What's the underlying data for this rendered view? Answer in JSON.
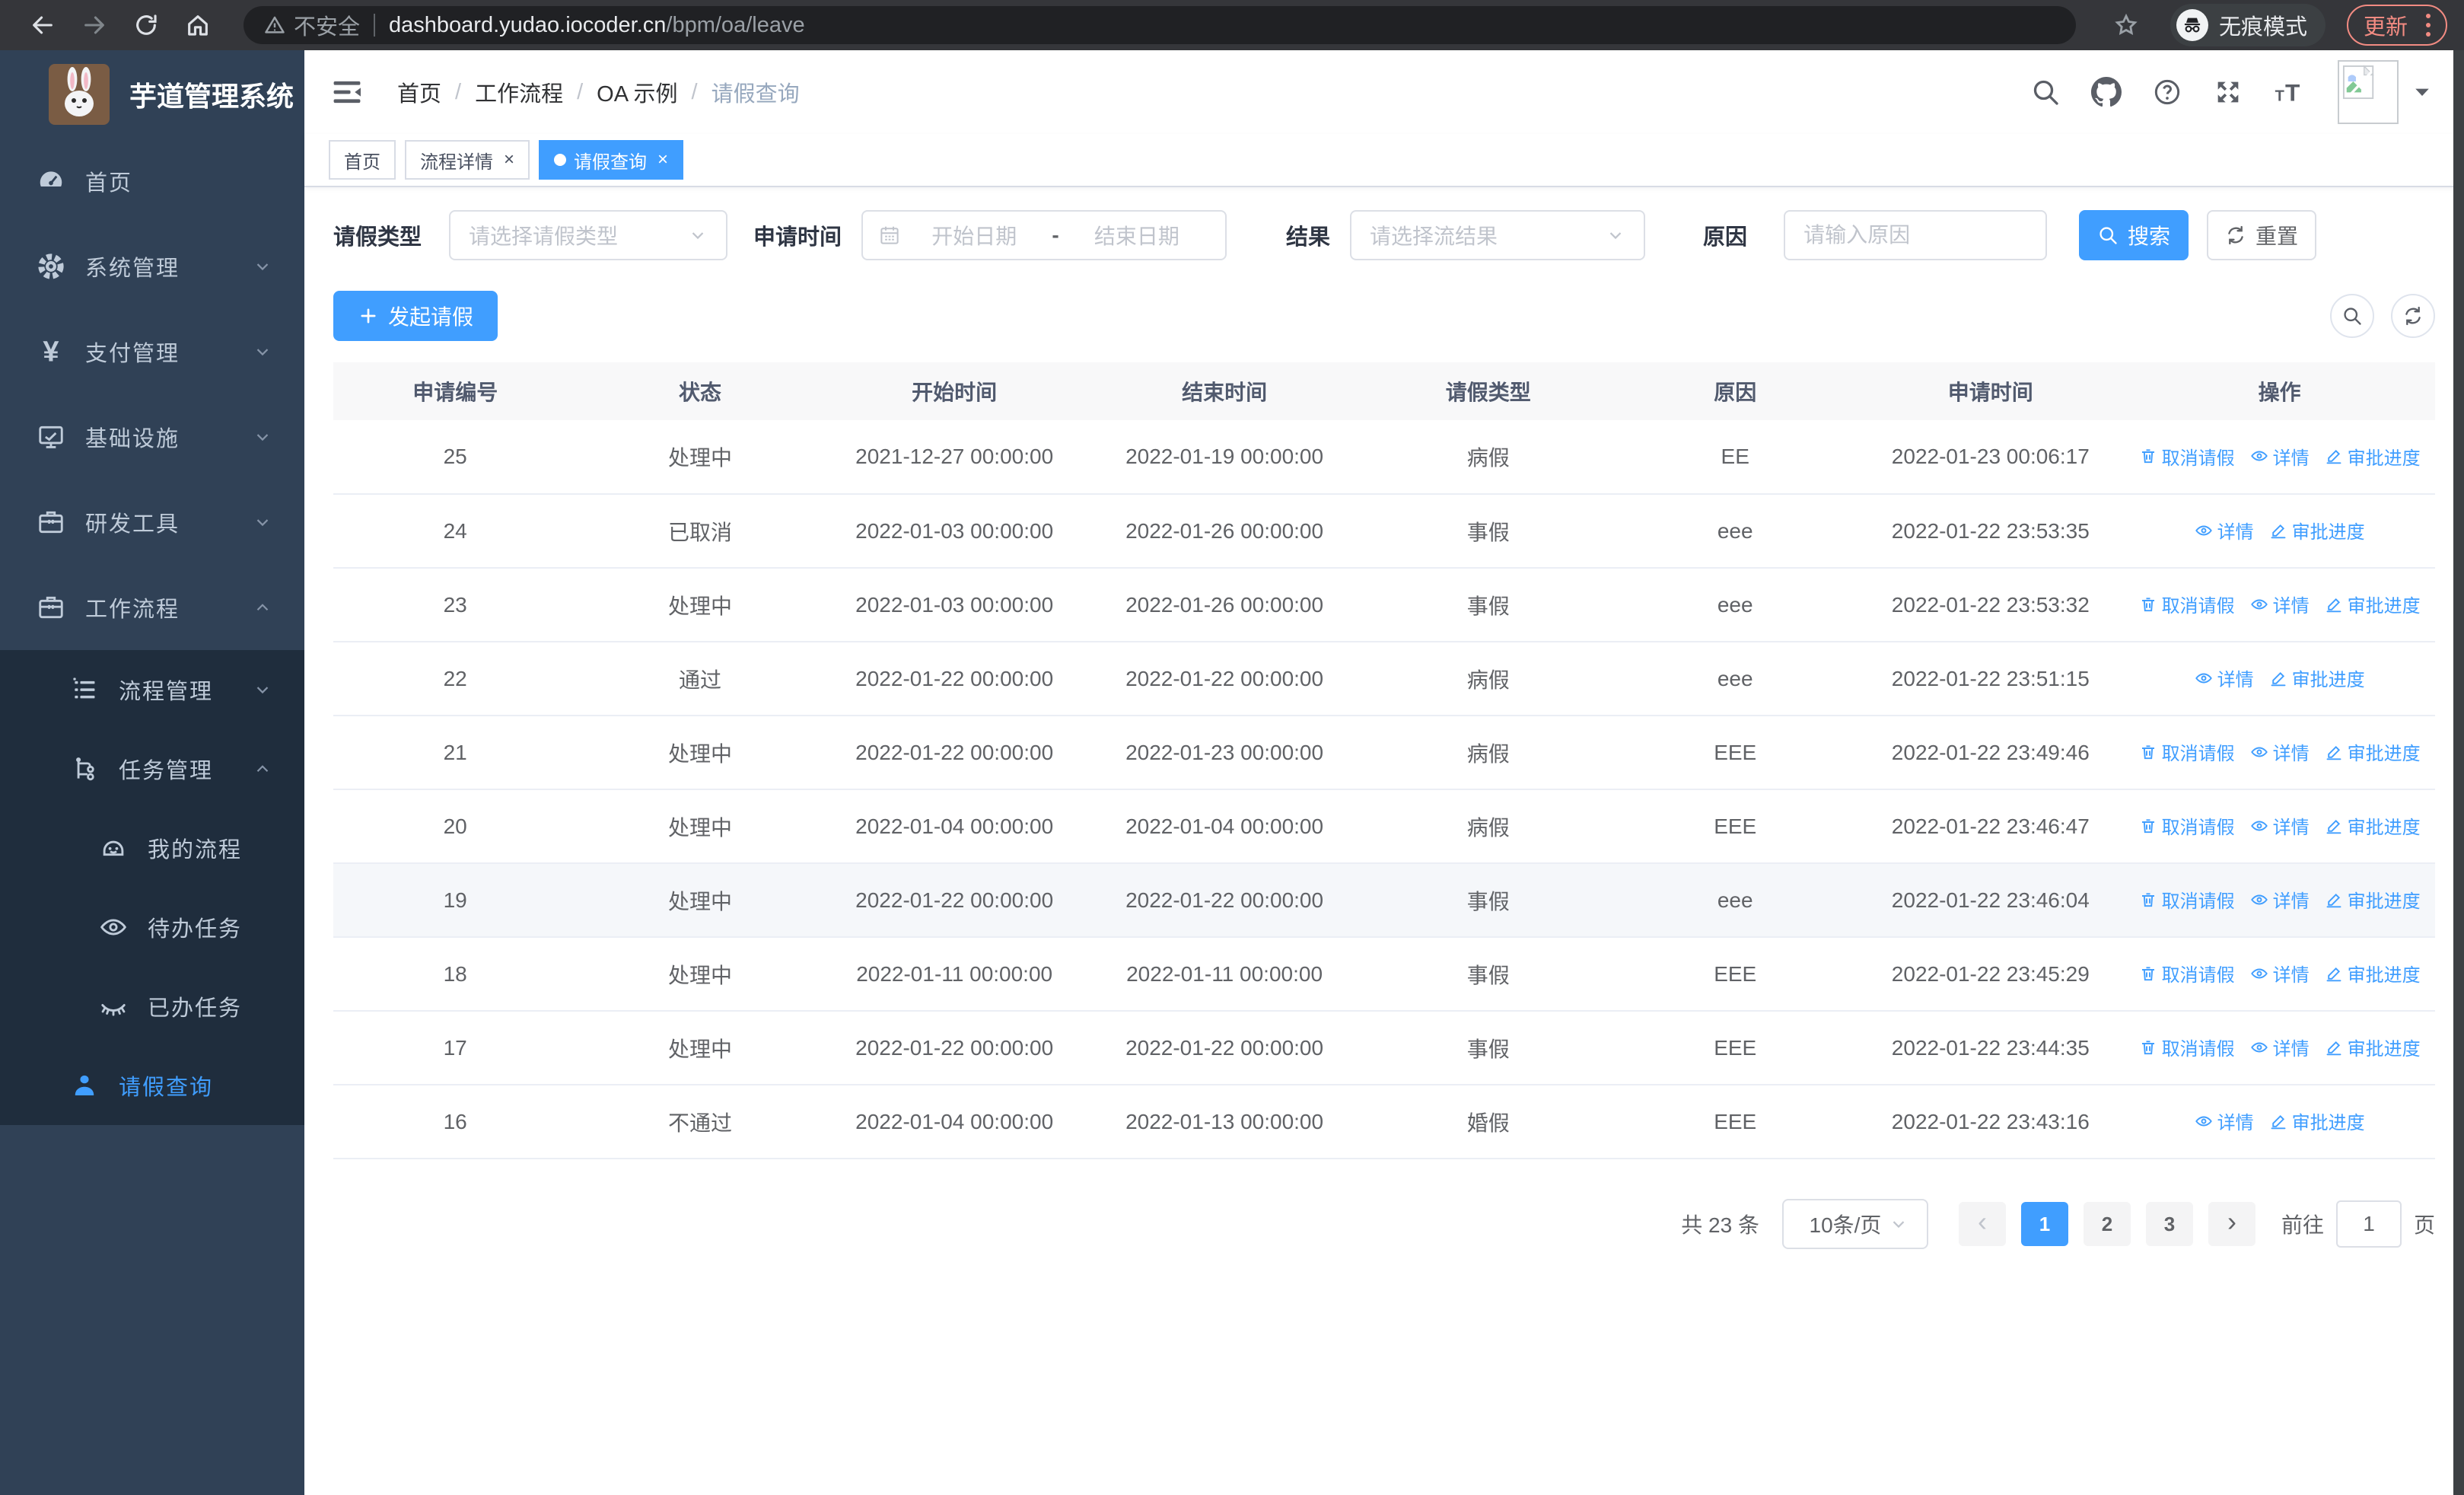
{
  "browser": {
    "security_label": "不安全",
    "url_host": "dashboard.yudao.iocoder.cn",
    "url_path": "/bpm/oa/leave",
    "incognito_label": "无痕模式",
    "update_label": "更新"
  },
  "sidebar": {
    "title": "芋道管理系统",
    "items": [
      {
        "id": "home",
        "label": "首页",
        "icon": "dashboard-icon",
        "level": 1,
        "chevron": null,
        "submenu": false,
        "active": false
      },
      {
        "id": "system",
        "label": "系统管理",
        "icon": "gear-icon",
        "level": 1,
        "chevron": "down",
        "submenu": false,
        "active": false
      },
      {
        "id": "pay",
        "label": "支付管理",
        "icon": "yen-icon",
        "level": 1,
        "chevron": "down",
        "submenu": false,
        "active": false
      },
      {
        "id": "infra",
        "label": "基础设施",
        "icon": "monitor-icon",
        "level": 1,
        "chevron": "down",
        "submenu": false,
        "active": false
      },
      {
        "id": "dev-tools",
        "label": "研发工具",
        "icon": "briefcase-icon",
        "level": 1,
        "chevron": "down",
        "submenu": false,
        "active": false
      },
      {
        "id": "workflow",
        "label": "工作流程",
        "icon": "briefcase-icon",
        "level": 1,
        "chevron": "up",
        "submenu": false,
        "active": false
      },
      {
        "id": "process-mgmt",
        "label": "流程管理",
        "icon": "list-icon",
        "level": 2,
        "chevron": "down",
        "submenu": true,
        "active": false
      },
      {
        "id": "task-mgmt",
        "label": "任务管理",
        "icon": "flow-icon",
        "level": 2,
        "chevron": "up",
        "submenu": true,
        "active": false
      },
      {
        "id": "my-process",
        "label": "我的流程",
        "icon": "robot-icon",
        "level": 3,
        "chevron": null,
        "submenu": true,
        "active": false
      },
      {
        "id": "todo-tasks",
        "label": "待办任务",
        "icon": "eye-icon",
        "level": 3,
        "chevron": null,
        "submenu": true,
        "active": false
      },
      {
        "id": "done-tasks",
        "label": "已办任务",
        "icon": "eye-closed-icon",
        "level": 3,
        "chevron": null,
        "submenu": true,
        "active": false
      },
      {
        "id": "leave-query",
        "label": "请假查询",
        "icon": "user-icon",
        "level": 2,
        "chevron": null,
        "submenu": true,
        "active": true
      }
    ]
  },
  "breadcrumb": {
    "separator": "/",
    "items": [
      "首页",
      "工作流程",
      "OA 示例",
      "请假查询"
    ]
  },
  "tabs": [
    {
      "label": "首页",
      "closable": false,
      "active": false
    },
    {
      "label": "流程详情",
      "closable": true,
      "active": false
    },
    {
      "label": "请假查询",
      "closable": true,
      "active": true
    }
  ],
  "filters": {
    "type_label": "请假类型",
    "type_placeholder": "请选择请假类型",
    "time_label": "申请时间",
    "start_placeholder": "开始日期",
    "separator": "-",
    "end_placeholder": "结束日期",
    "result_label": "结果",
    "result_placeholder": "请选择流结果",
    "reason_label": "原因",
    "reason_placeholder": "请输入原因",
    "search_label": "搜索",
    "reset_label": "重置"
  },
  "toolbar": {
    "create_label": "发起请假"
  },
  "action_defs": {
    "cancel": {
      "label": "取消请假",
      "icon": "delete"
    },
    "detail": {
      "label": "详情",
      "icon": "view"
    },
    "progress": {
      "label": "审批进度",
      "icon": "edit"
    }
  },
  "table": {
    "columns": [
      "申请编号",
      "状态",
      "开始时间",
      "结束时间",
      "请假类型",
      "原因",
      "申请时间",
      "操作"
    ],
    "rows": [
      {
        "id": "25",
        "status": "处理中",
        "start": "2021-12-27 00:00:00",
        "end": "2022-01-19 00:00:00",
        "type": "病假",
        "reason": "EE",
        "apply_time": "2022-01-23 00:06:17",
        "actions": [
          "cancel",
          "detail",
          "progress"
        ],
        "highlight": false
      },
      {
        "id": "24",
        "status": "已取消",
        "start": "2022-01-03 00:00:00",
        "end": "2022-01-26 00:00:00",
        "type": "事假",
        "reason": "eee",
        "apply_time": "2022-01-22 23:53:35",
        "actions": [
          "detail",
          "progress"
        ],
        "highlight": false
      },
      {
        "id": "23",
        "status": "处理中",
        "start": "2022-01-03 00:00:00",
        "end": "2022-01-26 00:00:00",
        "type": "事假",
        "reason": "eee",
        "apply_time": "2022-01-22 23:53:32",
        "actions": [
          "cancel",
          "detail",
          "progress"
        ],
        "highlight": false
      },
      {
        "id": "22",
        "status": "通过",
        "start": "2022-01-22 00:00:00",
        "end": "2022-01-22 00:00:00",
        "type": "病假",
        "reason": "eee",
        "apply_time": "2022-01-22 23:51:15",
        "actions": [
          "detail",
          "progress"
        ],
        "highlight": false
      },
      {
        "id": "21",
        "status": "处理中",
        "start": "2022-01-22 00:00:00",
        "end": "2022-01-23 00:00:00",
        "type": "病假",
        "reason": "EEE",
        "apply_time": "2022-01-22 23:49:46",
        "actions": [
          "cancel",
          "detail",
          "progress"
        ],
        "highlight": false
      },
      {
        "id": "20",
        "status": "处理中",
        "start": "2022-01-04 00:00:00",
        "end": "2022-01-04 00:00:00",
        "type": "病假",
        "reason": "EEE",
        "apply_time": "2022-01-22 23:46:47",
        "actions": [
          "cancel",
          "detail",
          "progress"
        ],
        "highlight": false
      },
      {
        "id": "19",
        "status": "处理中",
        "start": "2022-01-22 00:00:00",
        "end": "2022-01-22 00:00:00",
        "type": "事假",
        "reason": "eee",
        "apply_time": "2022-01-22 23:46:04",
        "actions": [
          "cancel",
          "detail",
          "progress"
        ],
        "highlight": true
      },
      {
        "id": "18",
        "status": "处理中",
        "start": "2022-01-11 00:00:00",
        "end": "2022-01-11 00:00:00",
        "type": "事假",
        "reason": "EEE",
        "apply_time": "2022-01-22 23:45:29",
        "actions": [
          "cancel",
          "detail",
          "progress"
        ],
        "highlight": false
      },
      {
        "id": "17",
        "status": "处理中",
        "start": "2022-01-22 00:00:00",
        "end": "2022-01-22 00:00:00",
        "type": "事假",
        "reason": "EEE",
        "apply_time": "2022-01-22 23:44:35",
        "actions": [
          "cancel",
          "detail",
          "progress"
        ],
        "highlight": false
      },
      {
        "id": "16",
        "status": "不通过",
        "start": "2022-01-04 00:00:00",
        "end": "2022-01-13 00:00:00",
        "type": "婚假",
        "reason": "EEE",
        "apply_time": "2022-01-22 23:43:16",
        "actions": [
          "detail",
          "progress"
        ],
        "highlight": false
      }
    ]
  },
  "pagination": {
    "total_text": "共 23 条",
    "page_size": "10条/页",
    "pages": [
      "1",
      "2",
      "3"
    ],
    "active_page": "1",
    "goto_label": "前往",
    "goto_value": "1",
    "goto_suffix": "页"
  },
  "colors": {
    "primary": "#409eff",
    "sidebar_bg": "#304156",
    "submenu_bg": "#1f2d3d",
    "menu_text": "#bfcbd9",
    "table_header_text": "#515a6e",
    "table_text": "#606266",
    "row_highlight": "#f5f7fa",
    "chrome_bar": "#35363a",
    "chrome_pill": "#202124",
    "update_accent": "#f28b82"
  }
}
